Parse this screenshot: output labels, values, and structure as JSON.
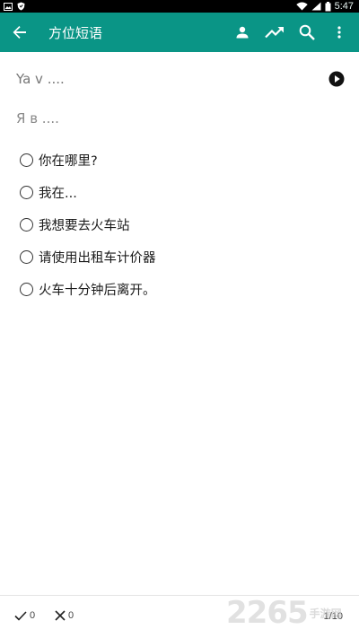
{
  "status_bar": {
    "time": "5:47",
    "icons": [
      "image-notification-icon",
      "shield-notification-icon",
      "wifi-icon",
      "signal-icon",
      "battery-icon"
    ]
  },
  "app_bar": {
    "title": "方位短语",
    "background": "#0a9586",
    "actions": [
      "person-icon",
      "trending-up-icon",
      "search-icon",
      "more-vert-icon"
    ]
  },
  "exercise": {
    "prompt": "Ya v ....",
    "answer": "Я в ....",
    "options": [
      "你在哪里?",
      "我在...",
      "我想要去火车站",
      "请使用出租车计价器",
      "火车十分钟后离开。"
    ]
  },
  "bottom_bar": {
    "correct_count": "0",
    "wrong_count": "0",
    "progress": "1/10"
  },
  "watermark": {
    "number": "2265",
    "text": "手游网"
  }
}
